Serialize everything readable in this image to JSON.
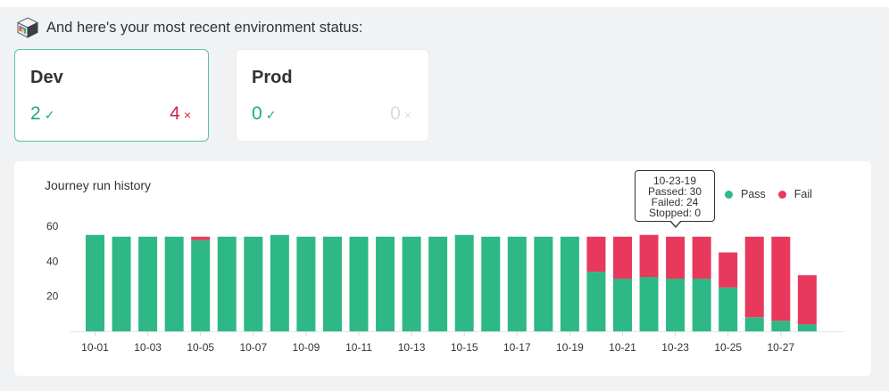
{
  "header": {
    "message": "And here's your most recent environment status:",
    "icon": "cube-icon"
  },
  "environments": [
    {
      "name": "Dev",
      "passed": "2",
      "failed": "4",
      "pass_mark": "✓",
      "fail_mark": "×",
      "selected": true
    },
    {
      "name": "Prod",
      "passed": "0",
      "failed": "0",
      "pass_mark": "✓",
      "fail_mark": "×",
      "selected": false
    }
  ],
  "colors": {
    "pass": "#2db886",
    "fail": "#e8395d",
    "pass_text": "#21a87e",
    "fail_text": "#d0263f",
    "muted": "#d9dcdf",
    "accent_border": "#55c4a3"
  },
  "chart": {
    "title": "Journey run history",
    "legend": {
      "pass": "Pass",
      "fail": "Fail"
    },
    "tooltip": {
      "date": "10-23-19",
      "passed": "Passed: 30",
      "failed": "Failed: 24",
      "stopped": "Stopped: 0"
    }
  },
  "chart_data": {
    "type": "bar",
    "stacked": true,
    "title": "Journey run history",
    "categories": [
      "10-01",
      "10-02",
      "10-03",
      "10-04",
      "10-05",
      "10-06",
      "10-07",
      "10-08",
      "10-09",
      "10-10",
      "10-11",
      "10-12",
      "10-13",
      "10-14",
      "10-15",
      "10-16",
      "10-17",
      "10-18",
      "10-19",
      "10-20",
      "10-21",
      "10-22",
      "10-23",
      "10-24",
      "10-25",
      "10-26",
      "10-27",
      "10-28"
    ],
    "x_tick_labels": [
      "10-01",
      "10-03",
      "10-05",
      "10-07",
      "10-09",
      "10-11",
      "10-13",
      "10-15",
      "10-17",
      "10-19",
      "10-21",
      "10-23",
      "10-25",
      "10-27"
    ],
    "series": [
      {
        "name": "Pass",
        "values": [
          55,
          54,
          54,
          54,
          52,
          54,
          54,
          55,
          54,
          54,
          54,
          54,
          54,
          54,
          55,
          54,
          54,
          54,
          54,
          34,
          30,
          31,
          30,
          30,
          25,
          8,
          6,
          4
        ]
      },
      {
        "name": "Fail",
        "values": [
          0,
          0,
          0,
          0,
          2,
          0,
          0,
          0,
          0,
          0,
          0,
          0,
          0,
          0,
          0,
          0,
          0,
          0,
          0,
          20,
          24,
          24,
          24,
          24,
          20,
          46,
          48,
          28
        ]
      }
    ],
    "y_ticks": [
      20,
      40,
      60
    ],
    "ylim": [
      0,
      62
    ],
    "grid": false,
    "legend_position": "top-right"
  }
}
